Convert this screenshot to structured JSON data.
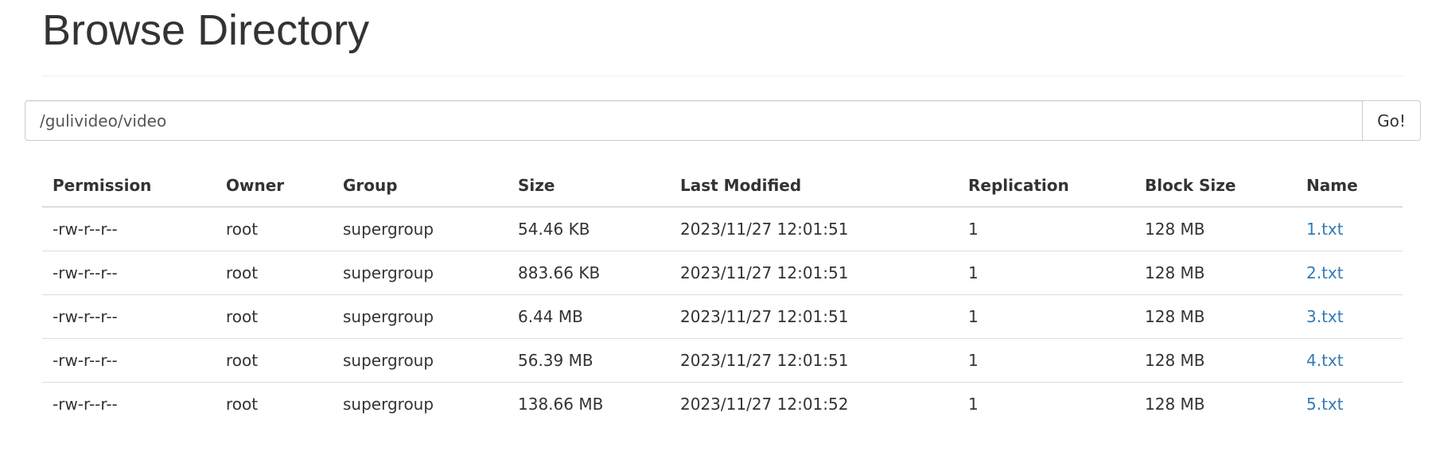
{
  "header": {
    "title": "Browse Directory"
  },
  "path_form": {
    "path_value": "/gulivideo/video",
    "go_label": "Go!"
  },
  "table": {
    "columns": [
      "Permission",
      "Owner",
      "Group",
      "Size",
      "Last Modified",
      "Replication",
      "Block Size",
      "Name"
    ],
    "rows": [
      {
        "permission": "-rw-r--r--",
        "owner": "root",
        "group": "supergroup",
        "size": "54.46 KB",
        "last_modified": "2023/11/27 12:01:51",
        "replication": "1",
        "block_size": "128 MB",
        "name": "1.txt"
      },
      {
        "permission": "-rw-r--r--",
        "owner": "root",
        "group": "supergroup",
        "size": "883.66 KB",
        "last_modified": "2023/11/27 12:01:51",
        "replication": "1",
        "block_size": "128 MB",
        "name": "2.txt"
      },
      {
        "permission": "-rw-r--r--",
        "owner": "root",
        "group": "supergroup",
        "size": "6.44 MB",
        "last_modified": "2023/11/27 12:01:51",
        "replication": "1",
        "block_size": "128 MB",
        "name": "3.txt"
      },
      {
        "permission": "-rw-r--r--",
        "owner": "root",
        "group": "supergroup",
        "size": "56.39 MB",
        "last_modified": "2023/11/27 12:01:51",
        "replication": "1",
        "block_size": "128 MB",
        "name": "4.txt"
      },
      {
        "permission": "-rw-r--r--",
        "owner": "root",
        "group": "supergroup",
        "size": "138.66 MB",
        "last_modified": "2023/11/27 12:01:52",
        "replication": "1",
        "block_size": "128 MB",
        "name": "5.txt"
      }
    ]
  },
  "colors": {
    "link": "#337ab7",
    "text": "#333333",
    "border": "#dddddd"
  }
}
